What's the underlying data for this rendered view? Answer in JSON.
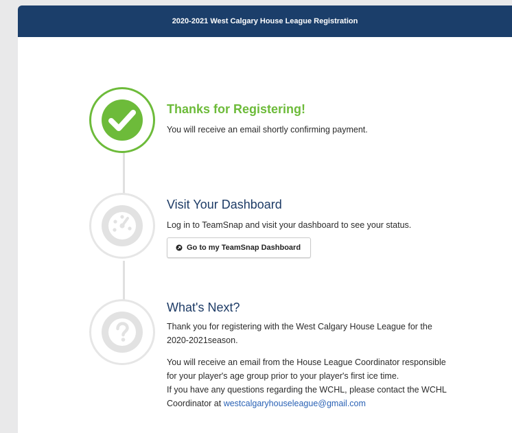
{
  "header": {
    "title": "2020-2021 West Calgary House League Registration"
  },
  "steps": [
    {
      "title": "Thanks for Registering!",
      "text": "You will receive an email shortly confirming payment.",
      "icon": "checkmark-icon",
      "status": "complete"
    },
    {
      "title": "Visit Your Dashboard",
      "text": "Log in to TeamSnap and visit your dashboard to see your status.",
      "icon": "dashboard-gauge-icon",
      "button_label": "Go to my TeamSnap Dashboard",
      "button_icon": "external-link-icon"
    },
    {
      "title": "What's Next?",
      "paragraph1": "Thank you for registering with the West Calgary House League for the 2020-2021season.",
      "paragraph2": "You will receive an email from the House League Coordinator responsible for your player's age group prior to your player's first ice time.",
      "paragraph3_prefix": "If you have any questions regarding the WCHL, please contact the WCHL Coordinator at ",
      "email": "westcalgaryhouseleague@gmail.com",
      "icon": "question-mark-icon"
    }
  ],
  "colors": {
    "header_bg": "#1b3e6a",
    "success_green": "#6dbb3a",
    "title_blue": "#1d3b66",
    "link_blue": "#2a62b5"
  }
}
